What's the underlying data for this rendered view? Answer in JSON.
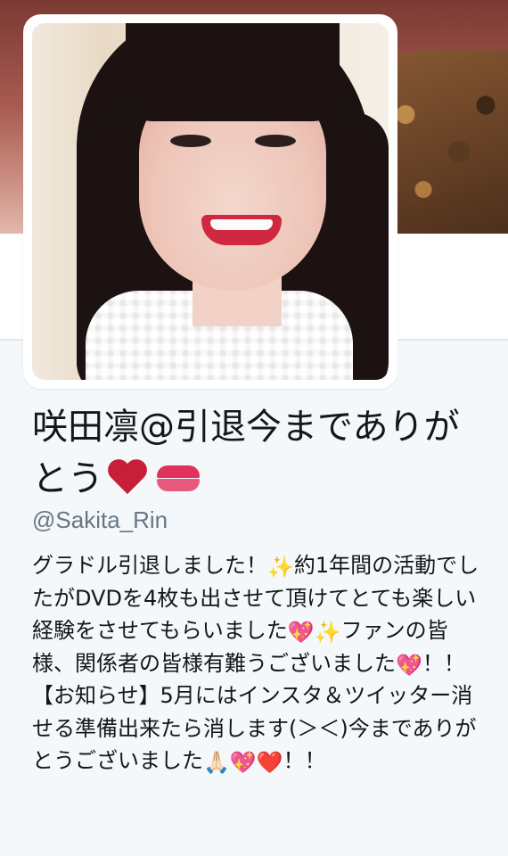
{
  "profile": {
    "display_name": "咲田凛@引退今までありがとう",
    "name_emoji_1": "❤️",
    "name_emoji_2": "💋",
    "handle": "@Sakita_Rin",
    "bio_part1": "グラドル引退しました！",
    "bio_part2": "約1年間の活動でしたがDVDを4枚も出させて頂けてとても楽しい経験をさせてもらいました",
    "bio_part3": "ファンの皆様、関係者の皆様有難うございました",
    "bio_part4": "！！【お知らせ】5月にはインスタ＆ツイッター消せる準備出来たら消します(＞＜)今までありがとうございました",
    "bio_part5": "！！",
    "emoji_sparkles": "✨",
    "emoji_sparkling_heart": "💖",
    "emoji_pray": "🙏🏻",
    "emoji_red_heart": "❤️"
  },
  "colors": {
    "page_bg": "#f5f8fa",
    "text": "#14171a",
    "secondary_text": "#657786"
  }
}
